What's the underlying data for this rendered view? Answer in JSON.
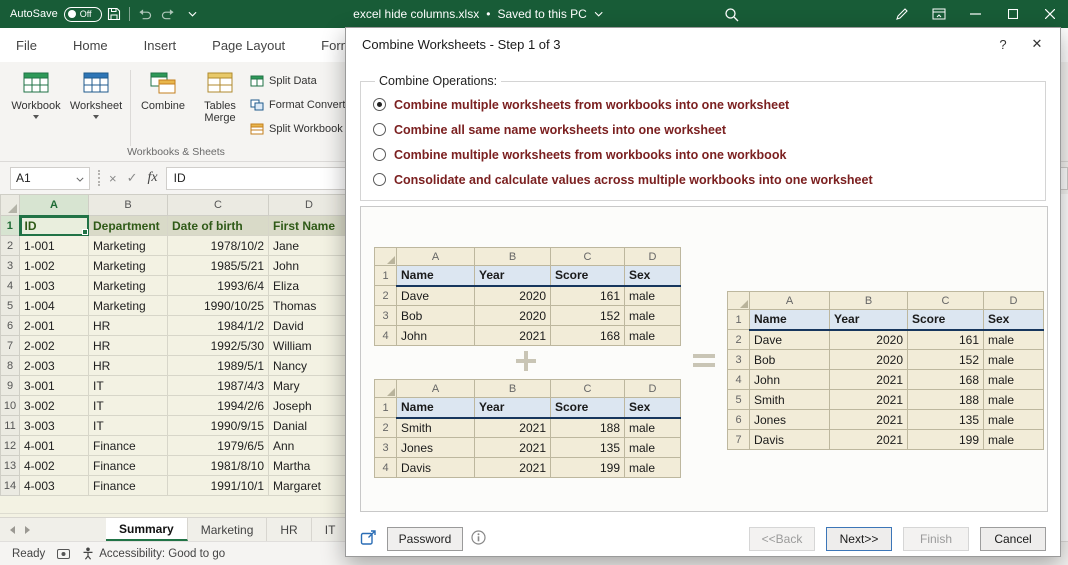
{
  "colors": {
    "titlebar_green": "#185C37",
    "accent_green": "#217346",
    "operation_text": "#7b2020",
    "preview_header_fill": "#dce6f1",
    "preview_header_border": "#17365d",
    "preview_cell_fill": "#f2ecd8"
  },
  "titlebar": {
    "autosave_label": "AutoSave",
    "autosave_state": "Off",
    "document_title": "excel hide columns.xlsx",
    "bullet": "•",
    "saved_status": "Saved to this PC"
  },
  "ribbon": {
    "tabs": [
      "File",
      "Home",
      "Insert",
      "Page Layout",
      "Formulas"
    ],
    "big_buttons": [
      "Workbook",
      "Worksheet",
      "Combine",
      "Tables Merge"
    ],
    "small_buttons": [
      "Split Data",
      "Format Convert",
      "Split Workbook"
    ],
    "group_label": "Workbooks & Sheets"
  },
  "formula_bar": {
    "name_box": "A1",
    "fx": "fx",
    "value": "ID"
  },
  "sheet": {
    "columns": [
      "A",
      "B",
      "C",
      "D"
    ],
    "header_row": [
      "ID",
      "Department",
      "Date of birth",
      "First Name"
    ],
    "rows": [
      [
        "1-001",
        "Marketing",
        "1978/10/2",
        "Jane"
      ],
      [
        "1-002",
        "Marketing",
        "1985/5/21",
        "John"
      ],
      [
        "1-003",
        "Marketing",
        "1993/6/4",
        "Eliza"
      ],
      [
        "1-004",
        "Marketing",
        "1990/10/25",
        "Thomas"
      ],
      [
        "2-001",
        "HR",
        "1984/1/2",
        "David"
      ],
      [
        "2-002",
        "HR",
        "1992/5/30",
        "William"
      ],
      [
        "2-003",
        "HR",
        "1989/5/1",
        "Nancy"
      ],
      [
        "3-001",
        "IT",
        "1987/4/3",
        "Mary"
      ],
      [
        "3-002",
        "IT",
        "1994/2/6",
        "Joseph"
      ],
      [
        "3-003",
        "IT",
        "1990/9/15",
        "Danial"
      ],
      [
        "4-001",
        "Finance",
        "1979/6/5",
        "Ann"
      ],
      [
        "4-002",
        "Finance",
        "1981/8/10",
        "Martha"
      ],
      [
        "4-003",
        "Finance",
        "1991/10/1",
        "Margaret"
      ]
    ]
  },
  "sheet_tabs": [
    "Summary",
    "Marketing",
    "HR",
    "IT"
  ],
  "status_bar": {
    "ready": "Ready",
    "accessibility": "Accessibility: Good to go"
  },
  "dialog": {
    "title": "Combine Worksheets - Step 1 of 3",
    "help": "?",
    "close": "✕",
    "operations_label": "Combine Operations:",
    "selected_operation": 0,
    "operations": [
      "Combine multiple worksheets from workbooks into one worksheet",
      "Combine all same name worksheets into one worksheet",
      "Combine multiple worksheets from workbooks into one workbook",
      "Consolidate and calculate values across multiple workbooks into one worksheet"
    ],
    "preview": {
      "columns": [
        "A",
        "B",
        "C",
        "D"
      ],
      "header": [
        "Name",
        "Year",
        "Score",
        "Sex"
      ],
      "table1": [
        [
          "Dave",
          "2020",
          "161",
          "male"
        ],
        [
          "Bob",
          "2020",
          "152",
          "male"
        ],
        [
          "John",
          "2021",
          "168",
          "male"
        ]
      ],
      "table2": [
        [
          "Smith",
          "2021",
          "188",
          "male"
        ],
        [
          "Jones",
          "2021",
          "135",
          "male"
        ],
        [
          "Davis",
          "2021",
          "199",
          "male"
        ]
      ],
      "result": [
        [
          "Dave",
          "2020",
          "161",
          "male"
        ],
        [
          "Bob",
          "2020",
          "152",
          "male"
        ],
        [
          "John",
          "2021",
          "168",
          "male"
        ],
        [
          "Smith",
          "2021",
          "188",
          "male"
        ],
        [
          "Jones",
          "2021",
          "135",
          "male"
        ],
        [
          "Davis",
          "2021",
          "199",
          "male"
        ]
      ]
    },
    "password_button": "Password",
    "buttons": {
      "back": "<<Back",
      "next": "Next>>",
      "finish": "Finish",
      "cancel": "Cancel"
    }
  }
}
